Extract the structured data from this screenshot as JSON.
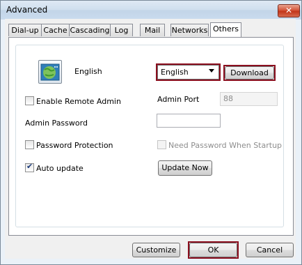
{
  "window": {
    "title": "Advanced",
    "close_glyph": "✕"
  },
  "tabs": [
    {
      "label": "Dial-up"
    },
    {
      "label": "Cache"
    },
    {
      "label": "Cascading"
    },
    {
      "label": "Log"
    },
    {
      "label": "Mail"
    },
    {
      "label": "Networks"
    },
    {
      "label": "Others",
      "active": true
    }
  ],
  "language": {
    "icon": "globe-language-icon",
    "label": "English",
    "selected": "English",
    "download_label": "Download"
  },
  "remote_admin": {
    "checkbox_label": "Enable Remote Admin",
    "checked": false,
    "port_label": "Admin Port",
    "port_value": "88"
  },
  "admin_password": {
    "label": "Admin Password",
    "value": ""
  },
  "password_protection": {
    "label": "Password Protection",
    "checked": false,
    "need_password_label": "Need Password When Startup",
    "need_password_checked": false
  },
  "auto_update": {
    "label": "Auto update",
    "checked": true,
    "update_now_label": "Update Now"
  },
  "footer": {
    "customize_label": "Customize",
    "ok_label": "OK",
    "cancel_label": "Cancel"
  },
  "colors": {
    "highlight": "#8b0e1e",
    "titlebar": "#cfdfee"
  }
}
